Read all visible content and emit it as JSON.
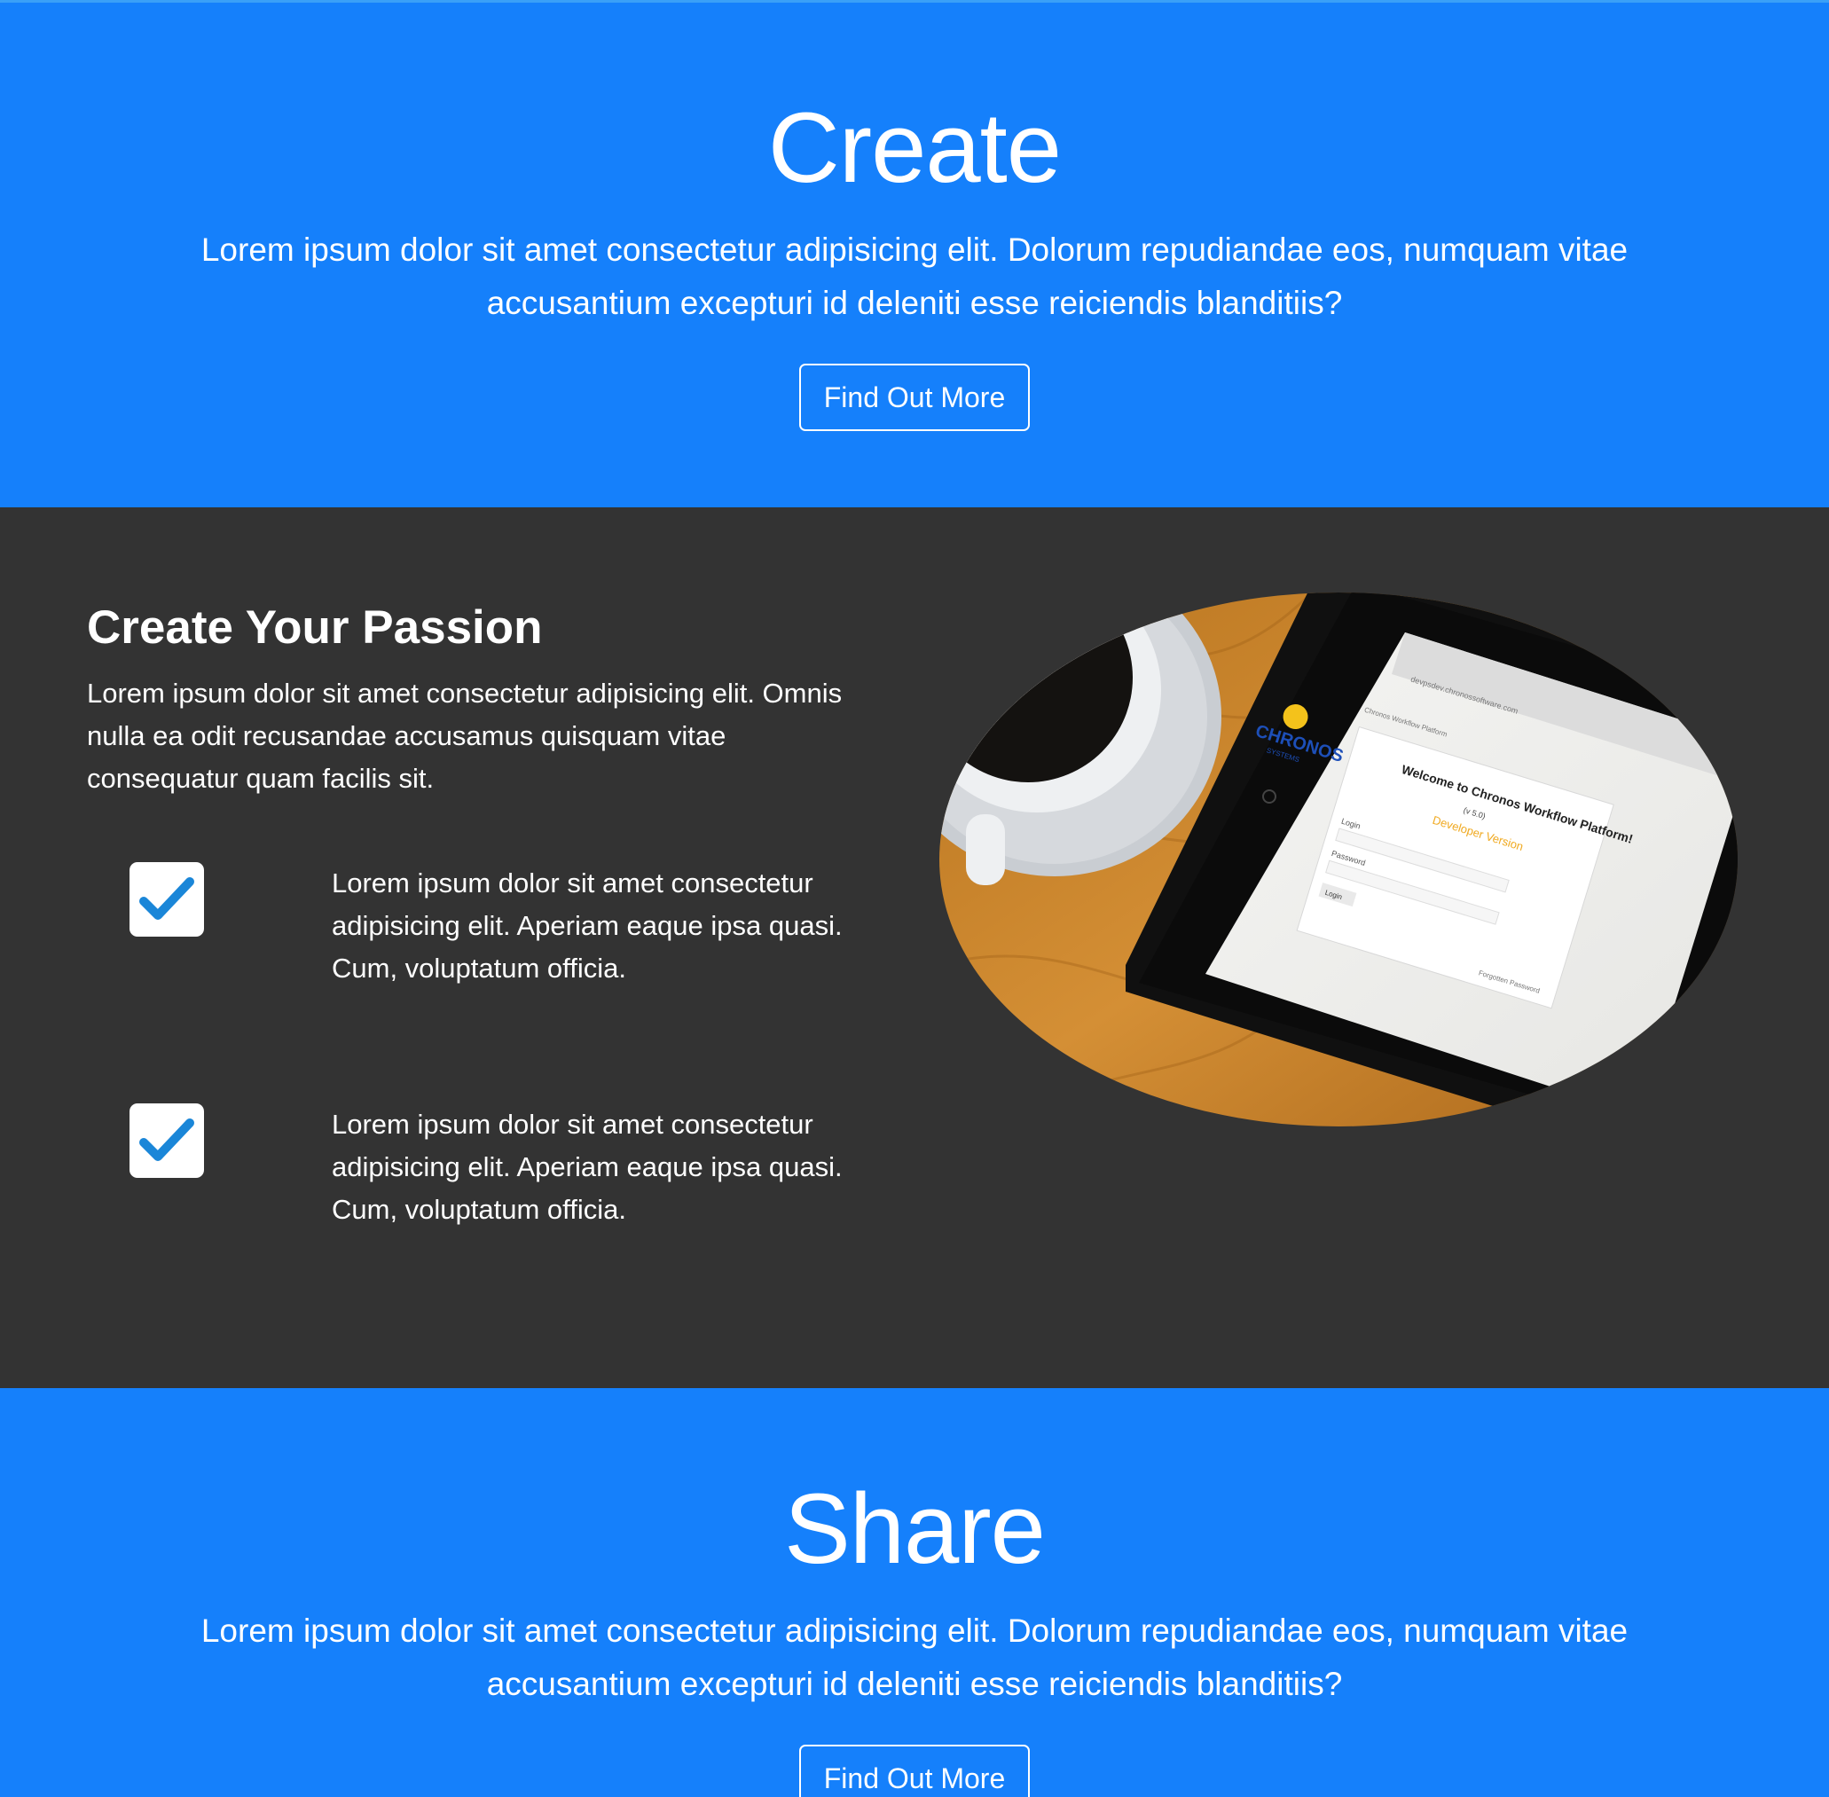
{
  "create": {
    "title": "Create",
    "text": "Lorem ipsum dolor sit amet consectetur adipisicing elit. Dolorum repudiandae eos, numquam vitae accusantium excepturi id deleniti esse reiciendis blanditiis?",
    "button_label": "Find Out More"
  },
  "passion": {
    "title": "Create Your Passion",
    "text": "Lorem ipsum dolor sit amet consectetur adipisicing elit. Omnis nulla ea odit recusandae accusamus quisquam vitae consequatur quam facilis sit.",
    "features": [
      {
        "icon": "checkbox-checked-icon",
        "text": "Lorem ipsum dolor sit amet consectetur adipisicing elit. Aperiam eaque ipsa quasi. Cum, voluptatum officia."
      },
      {
        "icon": "checkbox-checked-icon",
        "text": "Lorem ipsum dolor sit amet consectetur adipisicing elit. Aperiam eaque ipsa quasi. Cum, voluptatum officia."
      }
    ],
    "image": {
      "screen_brand": "CHRONOS",
      "screen_brand_sub": "SYSTEMS",
      "screen_heading": "Welcome to Chronos Workflow Platform!",
      "screen_version": "(v 5.0)",
      "screen_edition": "Developer Version",
      "screen_url": "devpsdev.chronossoftware.com",
      "screen_tab": "Chronos Workflow Platform",
      "screen_login_label": "Login",
      "screen_password_label": "Password",
      "screen_login_button": "Login",
      "screen_forgot": "Forgotten Password"
    }
  },
  "share": {
    "title": "Share",
    "text": "Lorem ipsum dolor sit amet consectetur adipisicing elit. Dolorum repudiandae eos, numquam vitae accusantium excepturi id deleniti esse reiciendis blanditiis?",
    "button_label": "Find Out More"
  },
  "colors": {
    "primary_blue": "#1580fb",
    "dark_bg": "#333333",
    "check_blue": "#1a86d8",
    "text": "#ffffff"
  }
}
